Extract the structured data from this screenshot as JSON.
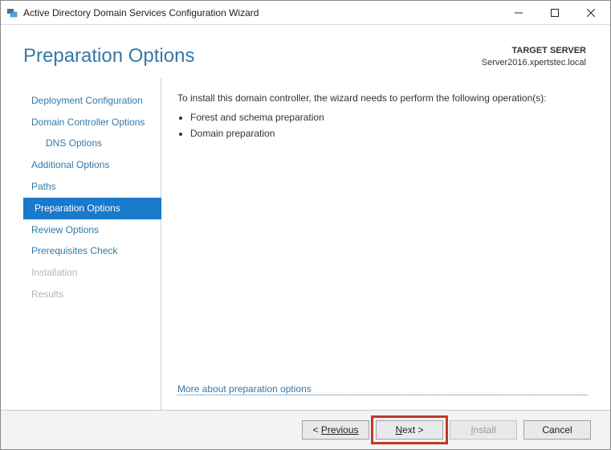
{
  "window": {
    "title": "Active Directory Domain Services Configuration Wizard"
  },
  "header": {
    "title": "Preparation Options",
    "target_label": "TARGET SERVER",
    "target_server": "Server2016.xpertstec.local"
  },
  "sidebar": {
    "items": [
      {
        "label": "Deployment Configuration",
        "indent": false,
        "active": false,
        "disabled": false
      },
      {
        "label": "Domain Controller Options",
        "indent": false,
        "active": false,
        "disabled": false
      },
      {
        "label": "DNS Options",
        "indent": true,
        "active": false,
        "disabled": false
      },
      {
        "label": "Additional Options",
        "indent": false,
        "active": false,
        "disabled": false
      },
      {
        "label": "Paths",
        "indent": false,
        "active": false,
        "disabled": false
      },
      {
        "label": "Preparation Options",
        "indent": false,
        "active": true,
        "disabled": false
      },
      {
        "label": "Review Options",
        "indent": false,
        "active": false,
        "disabled": false
      },
      {
        "label": "Prerequisites Check",
        "indent": false,
        "active": false,
        "disabled": false
      },
      {
        "label": "Installation",
        "indent": false,
        "active": false,
        "disabled": true
      },
      {
        "label": "Results",
        "indent": false,
        "active": false,
        "disabled": true
      }
    ]
  },
  "main": {
    "description": "To install this domain controller, the wizard needs to perform the following operation(s):",
    "bullets": [
      "Forest and schema preparation",
      "Domain preparation"
    ],
    "link": "More about preparation options"
  },
  "footer": {
    "previous": "Previous",
    "next": "Next >",
    "install": "Install",
    "cancel": "Cancel"
  }
}
